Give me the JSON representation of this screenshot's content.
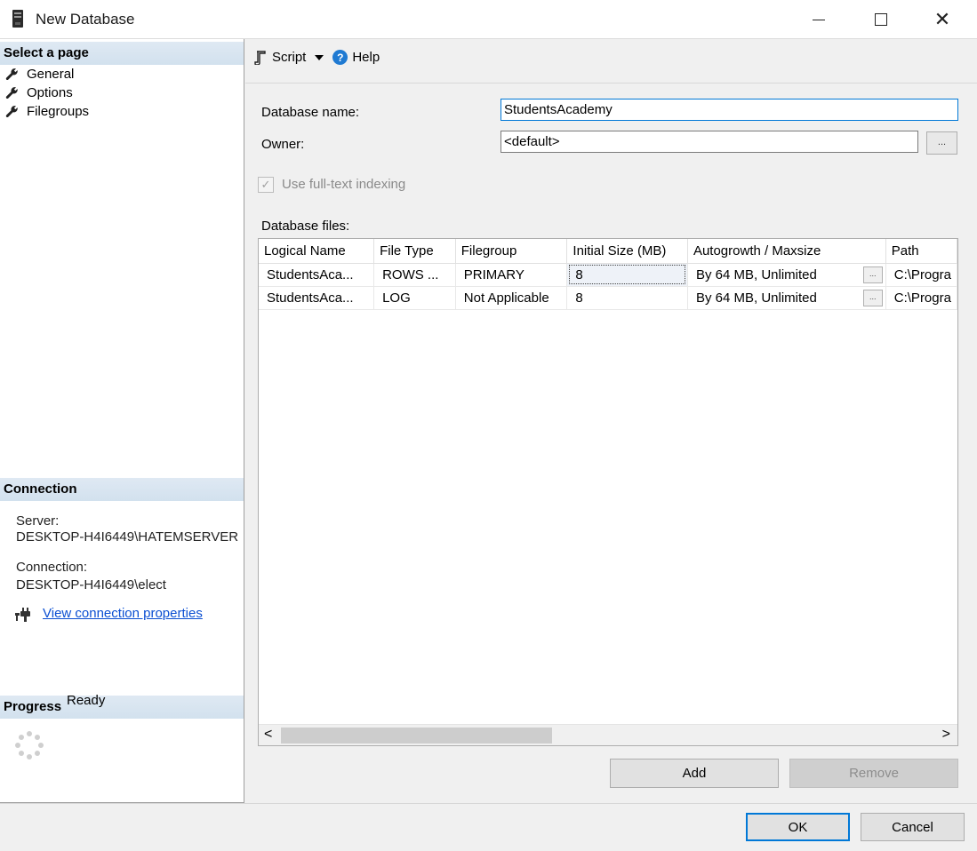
{
  "window": {
    "title": "New Database",
    "close_glyph": "✕"
  },
  "left_pane": {
    "select_page_header": "Select a page",
    "pages": [
      {
        "label": "General",
        "icon": "wrench-icon"
      },
      {
        "label": "Options",
        "icon": "wrench-icon"
      },
      {
        "label": "Filegroups",
        "icon": "wrench-icon"
      }
    ],
    "connection_header": "Connection",
    "server_label": "Server:",
    "server_value": "DESKTOP-H4I6449\\HATEMSERVER",
    "connection_label": "Connection:",
    "connection_value": "DESKTOP-H4I6449\\elect",
    "view_connection_link": "View connection properties",
    "progress_header": "Progress",
    "progress_status": "Ready"
  },
  "toolbar": {
    "script_label": "Script",
    "help_label": "Help",
    "help_glyph": "?"
  },
  "form": {
    "database_name_label": "Database name:",
    "database_name_value": "StudentsAcademy",
    "owner_label": "Owner:",
    "owner_value": "<default>",
    "ellipsis": "...",
    "fulltext_checkbox_label": "Use full-text indexing",
    "fulltext_checked": true,
    "check_glyph": "✓",
    "database_files_label": "Database files:"
  },
  "files_table": {
    "columns": [
      "Logical Name",
      "File Type",
      "Filegroup",
      "Initial Size (MB)",
      "Autogrowth / Maxsize",
      "Path"
    ],
    "rows": [
      {
        "logical_name": "StudentsAca...",
        "file_type": "ROWS ...",
        "filegroup": "PRIMARY",
        "initial_size": "8",
        "autogrowth": "By 64 MB, Unlimited",
        "path": "C:\\Progra"
      },
      {
        "logical_name": "StudentsAca...",
        "file_type": "LOG",
        "filegroup": "Not Applicable",
        "initial_size": "8",
        "autogrowth": "By 64 MB, Unlimited",
        "path": "C:\\Progra"
      }
    ],
    "cell_ellipsis": "...",
    "scroll_left_glyph": "<",
    "scroll_right_glyph": ">"
  },
  "buttons": {
    "add": "Add",
    "remove": "Remove",
    "ok": "OK",
    "cancel": "Cancel"
  },
  "colors": {
    "accent": "#0078d7",
    "link": "#0b4fd2",
    "section_header": "#d2e1ee"
  }
}
